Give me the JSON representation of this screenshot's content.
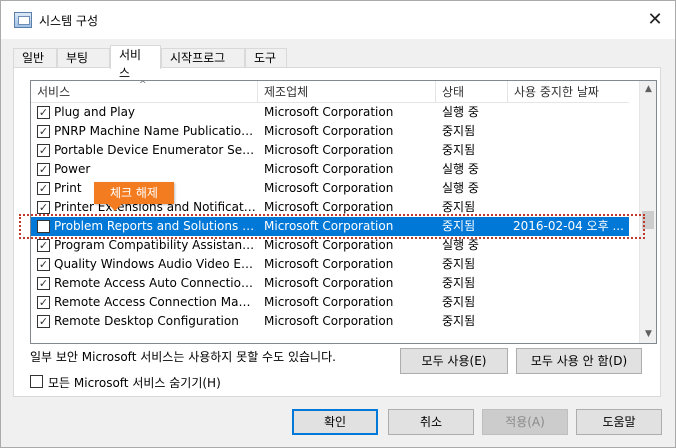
{
  "window": {
    "title": "시스템 구성",
    "close_glyph": "✕"
  },
  "tabs": [
    "일반",
    "부팅",
    "서비스",
    "시작프로그램",
    "도구"
  ],
  "list": {
    "columns": [
      "서비스",
      "제조업체",
      "상태",
      "사용 중지한 날짜"
    ],
    "rows": [
      {
        "checked": true,
        "name": "Plug and Play",
        "mfr": "Microsoft Corporation",
        "status": "실행 중",
        "date": ""
      },
      {
        "checked": true,
        "name": "PNRP Machine Name Publication S...",
        "mfr": "Microsoft Corporation",
        "status": "중지됨",
        "date": ""
      },
      {
        "checked": true,
        "name": "Portable Device Enumerator Service",
        "mfr": "Microsoft Corporation",
        "status": "중지됨",
        "date": ""
      },
      {
        "checked": true,
        "name": "Power",
        "mfr": "Microsoft Corporation",
        "status": "실행 중",
        "date": ""
      },
      {
        "checked": true,
        "name": "Print",
        "mfr": "Microsoft Corporation",
        "status": "실행 중",
        "date": ""
      },
      {
        "checked": true,
        "name": "Printer Extensions and Notifications",
        "mfr": "Microsoft Corporation",
        "status": "중지됨",
        "date": ""
      },
      {
        "checked": false,
        "name": "Problem Reports and Solutions Con...",
        "mfr": "Microsoft Corporation",
        "status": "중지됨",
        "date": "2016-02-04 오후 ...",
        "selected": true
      },
      {
        "checked": true,
        "name": "Program Compatibility Assistant Se...",
        "mfr": "Microsoft Corporation",
        "status": "실행 중",
        "date": ""
      },
      {
        "checked": true,
        "name": "Quality Windows Audio Video Expe...",
        "mfr": "Microsoft Corporation",
        "status": "중지됨",
        "date": ""
      },
      {
        "checked": true,
        "name": "Remote Access Auto Connection M...",
        "mfr": "Microsoft Corporation",
        "status": "중지됨",
        "date": ""
      },
      {
        "checked": true,
        "name": "Remote Access Connection Manager",
        "mfr": "Microsoft Corporation",
        "status": "중지됨",
        "date": ""
      },
      {
        "checked": true,
        "name": "Remote Desktop Configuration",
        "mfr": "Microsoft Corporation",
        "status": "중지됨",
        "date": ""
      }
    ]
  },
  "callout": {
    "text": "체크 해제"
  },
  "note": "일부 보안 Microsoft 서비스는 사용하지 못할 수도 있습니다.",
  "buttons": {
    "enable_all": "모두 사용(E)",
    "disable_all": "모두 사용 안 함(D)",
    "ok": "확인",
    "cancel": "취소",
    "apply": "적용(A)",
    "help": "도움말"
  },
  "hide_ms_label": "모든 Microsoft 서비스 숨기기(H)",
  "colors": {
    "selection": "#0078d7",
    "callout": "#f47c20",
    "highlight": "#c0392b"
  }
}
